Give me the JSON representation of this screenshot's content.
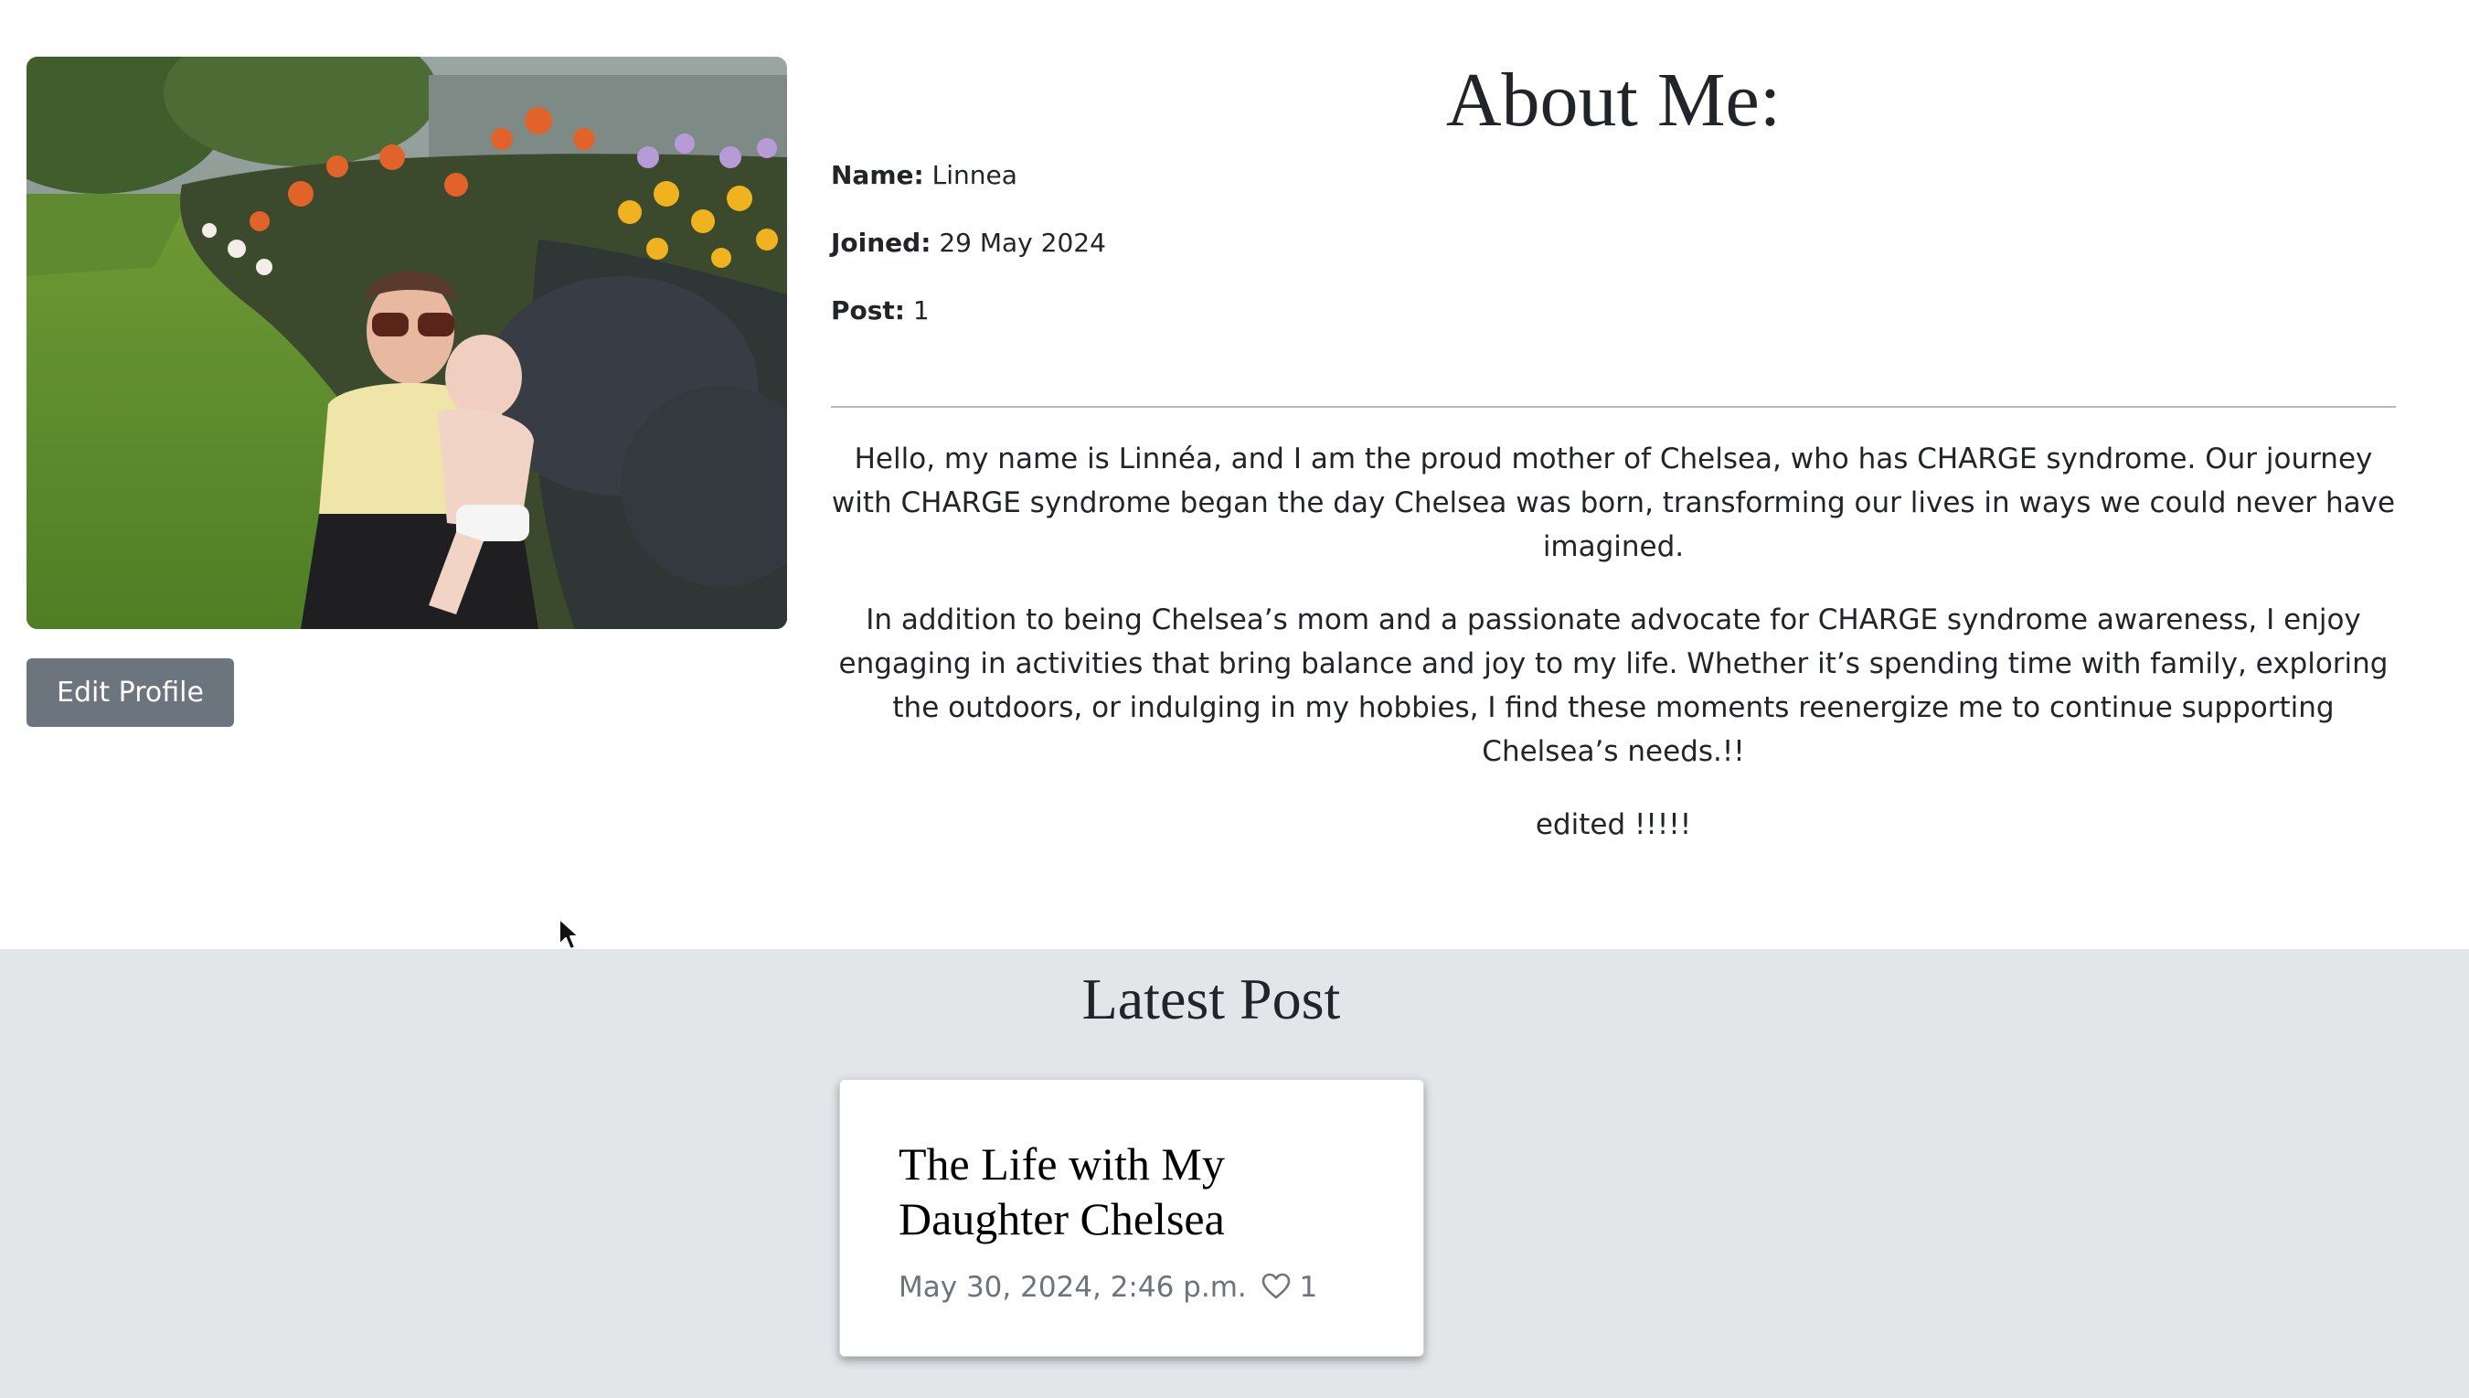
{
  "profile": {
    "photo_alt": "Profile photo",
    "edit_button": "Edit Profile"
  },
  "about": {
    "title": "About Me:",
    "name_label": "Name:",
    "name_value": "Linnea",
    "joined_label": "Joined:",
    "joined_value": "29 May 2024",
    "posts_label": "Post:",
    "posts_value": "1",
    "bio": [
      "Hello, my name is Linnéa, and I am the proud mother of Chelsea, who has CHARGE syndrome. Our journey with CHARGE syndrome began the day Chelsea was born, transforming our lives in ways we could never have imagined.",
      "In addition to being Chelsea’s mom and a passionate advocate for CHARGE syndrome awareness, I enjoy engaging in activities that bring balance and joy to my life. Whether it’s spending time with family, exploring the outdoors, or indulging in my hobbies, I find these moments reenergize me to continue supporting Chelsea’s needs.!!",
      "edited !!!!!"
    ]
  },
  "latest_post": {
    "heading": "Latest Post",
    "card": {
      "title": "The Life with My Daughter Chelsea",
      "date": "May 30, 2024, 2:46 p.m.",
      "likes": "1",
      "like_icon": "heart-outline-icon"
    }
  },
  "colors": {
    "button_bg": "#6c757d",
    "button_text": "#ffffff",
    "section_bg": "#e2e6e9",
    "muted_text": "#6c757d",
    "body_text": "#212529"
  }
}
